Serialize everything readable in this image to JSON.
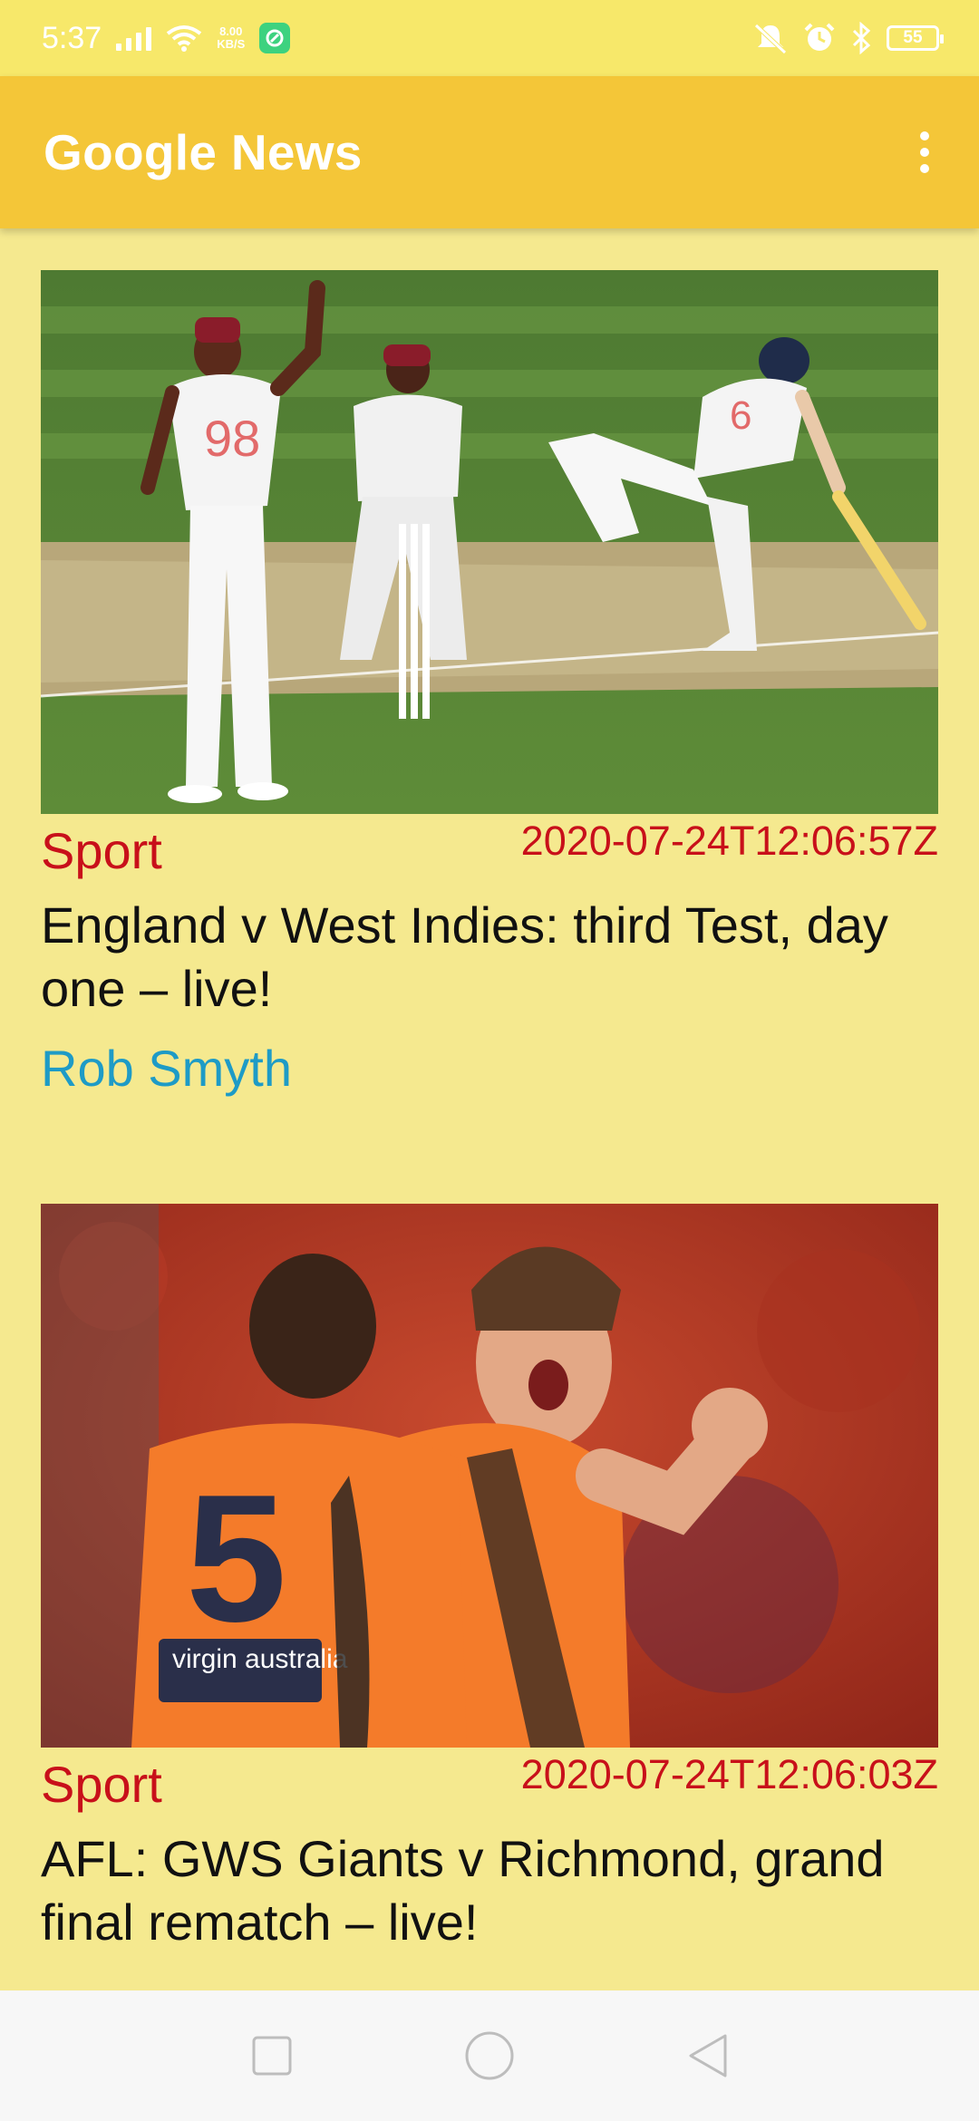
{
  "status_bar": {
    "time": "5:37",
    "network_speed": "8.00\nKB/S",
    "battery": "55",
    "icons": [
      "signal-icon",
      "wifi-icon",
      "app-badge-icon",
      "mute-vibrate-icon",
      "alarm-icon",
      "bluetooth-icon",
      "battery-icon"
    ]
  },
  "app_bar": {
    "title": "Google News",
    "menu_icon": "overflow-menu-icon"
  },
  "articles": [
    {
      "category": "Sport",
      "timestamp": "2020-07-24T12:06:57Z",
      "headline": "England v West Indies: third Test, day one – live!",
      "author": "Rob Smyth",
      "image": "cricket-photo",
      "jersey_numbers": [
        "98",
        "6"
      ]
    },
    {
      "category": "Sport",
      "timestamp": "2020-07-24T12:06:03Z",
      "headline": "AFL: GWS Giants v Richmond, grand final rematch – live!",
      "author": "",
      "image": "afl-photo",
      "jersey_number": "5",
      "sponsor": "virgin australia"
    }
  ],
  "nav_bar": {
    "icons": [
      "recents-icon",
      "home-icon",
      "back-icon"
    ]
  },
  "colors": {
    "background": "#F5E98F",
    "app_bar": "#F4C638",
    "status_bar": "#F7E86A",
    "category": "#C8101A",
    "author": "#1E9BC6"
  }
}
